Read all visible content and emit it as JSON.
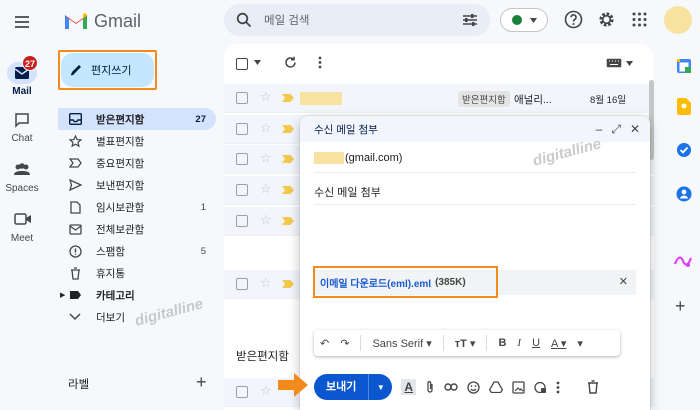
{
  "app": {
    "name": "Gmail"
  },
  "rail": [
    {
      "label": "Mail",
      "icon": "mail-icon",
      "badge": "27"
    },
    {
      "label": "Chat",
      "icon": "chat-icon"
    },
    {
      "label": "Spaces",
      "icon": "spaces-icon"
    },
    {
      "label": "Meet",
      "icon": "meet-icon"
    }
  ],
  "compose_button": {
    "label": "편지쓰기"
  },
  "nav": [
    {
      "label": "받은편지함",
      "count": "27",
      "icon": "inbox-icon"
    },
    {
      "label": "별표편지함",
      "count": "",
      "icon": "star-icon"
    },
    {
      "label": "중요편지함",
      "count": "",
      "icon": "important-icon"
    },
    {
      "label": "보낸편지함",
      "count": "",
      "icon": "send-icon"
    },
    {
      "label": "임시보관함",
      "count": "1",
      "icon": "draft-icon"
    },
    {
      "label": "전체보관함",
      "count": "",
      "icon": "all-mail-icon"
    },
    {
      "label": "스팸함",
      "count": "5",
      "icon": "spam-icon"
    },
    {
      "label": "휴지통",
      "count": "",
      "icon": "trash-icon"
    },
    {
      "label": "카테고리",
      "count": "",
      "icon": "label-icon"
    },
    {
      "label": "더보기",
      "count": "",
      "icon": "chevron-down-icon"
    }
  ],
  "labels_section": {
    "title": "라벨",
    "add": "+"
  },
  "search": {
    "placeholder": "메일 검색"
  },
  "email_row": {
    "chip": "받은편지함",
    "subject": "애널리...",
    "date": "8월 16일"
  },
  "inbox_footer": "받은편지함",
  "compose_window": {
    "title": "수신 메일 첨부",
    "to_suffix": "(gmail.com)",
    "subject": "수신 메일 첨부",
    "attachment": {
      "name": "이메일 다운로드(eml).eml",
      "size": "(385K)"
    },
    "font": "Sans Serif",
    "send_label": "보내기"
  },
  "watermark": "digitalline",
  "colors": {
    "highlight": "#f28b1b",
    "accent": "#0b57d0",
    "compose_bg": "#c2e7ff"
  }
}
